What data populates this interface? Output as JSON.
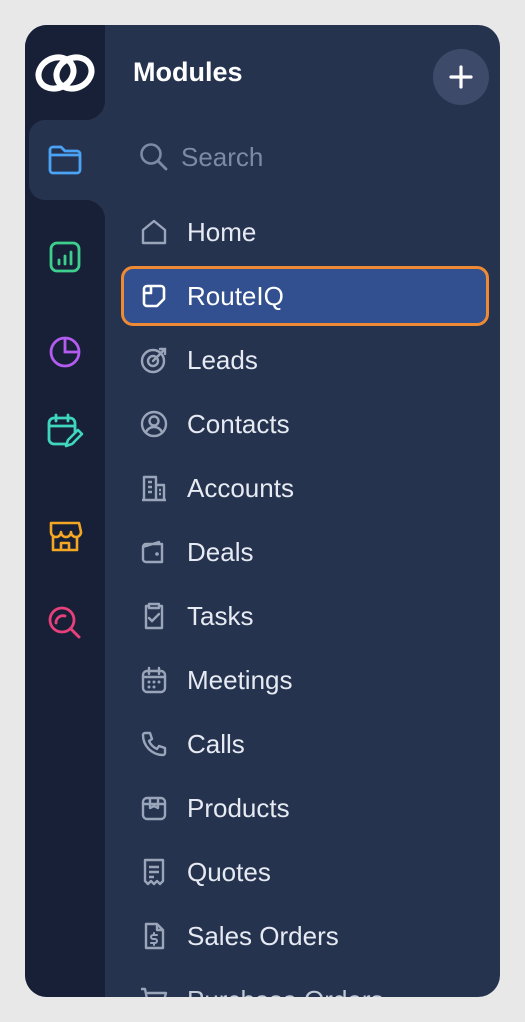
{
  "panel": {
    "title": "Modules",
    "add_icon": "plus-icon"
  },
  "search": {
    "placeholder": "Search",
    "icon": "search-icon"
  },
  "rail": {
    "logo": "crm-logo-icon",
    "items": [
      {
        "icon": "folder-icon",
        "color": "#4aa3f5",
        "active": true
      },
      {
        "icon": "bar-chart-icon",
        "color": "#3ecf8e"
      },
      {
        "icon": "pie-chart-icon",
        "color": "#b45cf0"
      },
      {
        "icon": "calendar-edit-icon",
        "color": "#3fd6c0"
      },
      {
        "icon": "store-icon",
        "color": "#f5a623"
      },
      {
        "icon": "search-analytics-icon",
        "color": "#e8407a"
      }
    ]
  },
  "nav": {
    "items": [
      {
        "label": "Home",
        "icon": "home-icon"
      },
      {
        "label": "RouteIQ",
        "icon": "note-icon",
        "active": true
      },
      {
        "label": "Leads",
        "icon": "target-icon"
      },
      {
        "label": "Contacts",
        "icon": "user-circle-icon"
      },
      {
        "label": "Accounts",
        "icon": "building-icon"
      },
      {
        "label": "Deals",
        "icon": "wallet-icon"
      },
      {
        "label": "Tasks",
        "icon": "clipboard-check-icon"
      },
      {
        "label": "Meetings",
        "icon": "calendar-icon"
      },
      {
        "label": "Calls",
        "icon": "phone-icon"
      },
      {
        "label": "Products",
        "icon": "box-icon"
      },
      {
        "label": "Quotes",
        "icon": "receipt-icon"
      },
      {
        "label": "Sales Orders",
        "icon": "dollar-doc-icon"
      },
      {
        "label": "Purchase Orders",
        "icon": "cart-icon"
      }
    ]
  },
  "colors": {
    "rail_bg": "#172036",
    "panel_bg": "#26334f",
    "active_bg": "#32508f",
    "active_border": "#ef8a34"
  }
}
